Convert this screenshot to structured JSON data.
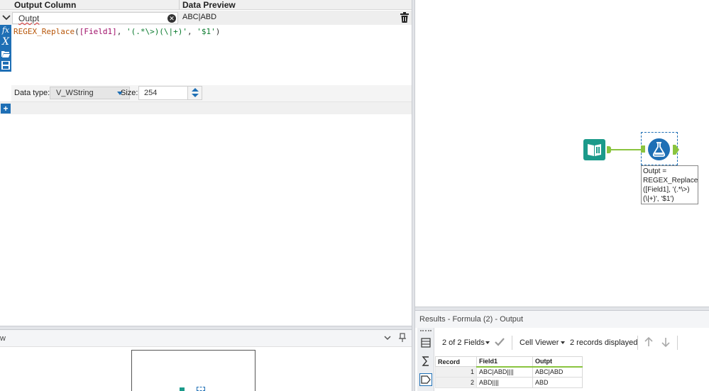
{
  "formula_grid": {
    "header": {
      "output_column": "Output Column",
      "data_preview": "Data Preview"
    },
    "row": {
      "output_name": "Outpt",
      "preview": "ABC|ABD",
      "expression": {
        "fn": "REGEX_Replace",
        "open": "(",
        "field": "[Field1]",
        "sep1": ", ",
        "pattern": "'(.*\\>)(\\|+)'",
        "sep2": ", ",
        "replacement": "'$1'",
        "close": ")"
      }
    },
    "data_type_label": "Data type:",
    "data_type_value": "V_WString",
    "size_label": "Size:",
    "size_value": "254",
    "tool_icons": [
      "fx-icon",
      "variable-x-icon",
      "folder-open-icon",
      "save-icon"
    ],
    "add_icon": "plus-icon"
  },
  "overview": {
    "title": "w"
  },
  "canvas": {
    "annotation": "Outpt =\nREGEX_Replace\n([Field1], '(.*\\>)\n(\\|+)', '$1')"
  },
  "results": {
    "title": "Results - Formula (2) - Output",
    "fields_dropdown": "2 of 2 Fields",
    "cell_viewer": "Cell Viewer",
    "records_count": "2 records displayed",
    "columns": [
      "Record",
      "Field1",
      "Outpt"
    ],
    "rows": [
      {
        "record": "1",
        "field1": "ABC|ABD||||",
        "outpt": "ABC|ABD"
      },
      {
        "record": "2",
        "field1": "ABD||||",
        "outpt": "ABD"
      }
    ]
  },
  "colors": {
    "accent": "#1e6fb5",
    "connector": "#8ac43f",
    "input_tool": "#1b9a8a"
  }
}
